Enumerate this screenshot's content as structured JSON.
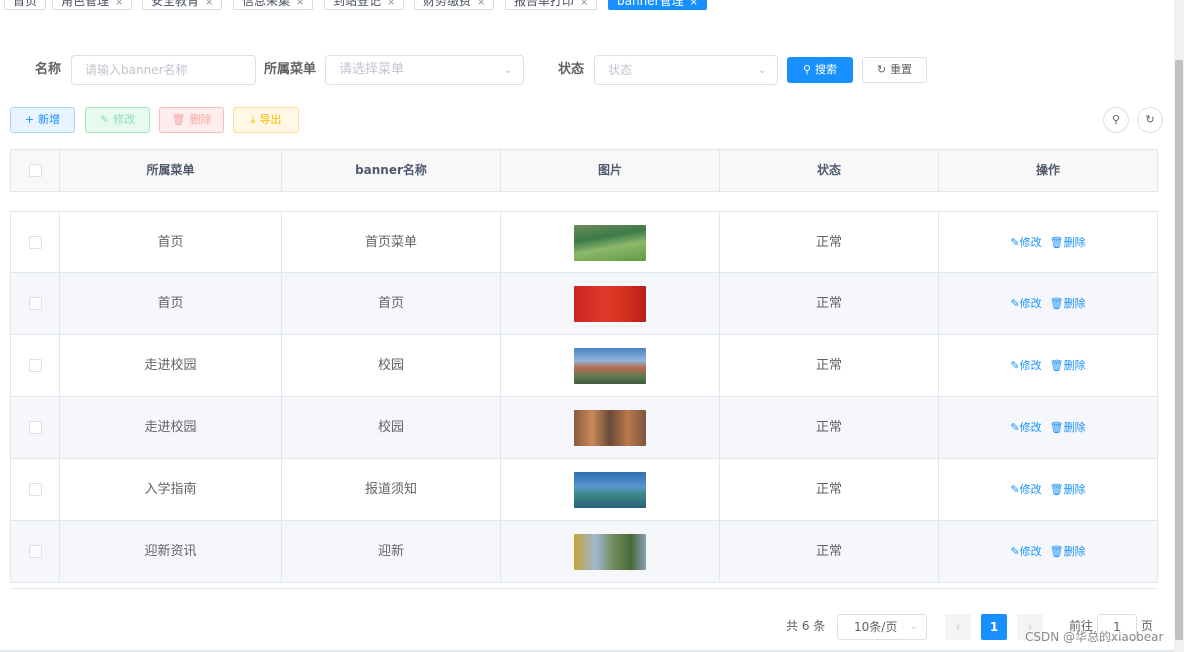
{
  "tags": [
    {
      "label": "首页",
      "closable": false
    },
    {
      "label": "角色管理",
      "closable": true
    },
    {
      "label": "安全教育",
      "closable": true
    },
    {
      "label": "信息采集",
      "closable": true
    },
    {
      "label": "到站登记",
      "closable": true
    },
    {
      "label": "财务缴费",
      "closable": true
    },
    {
      "label": "报告单打印",
      "closable": true
    },
    {
      "label": "banner管理",
      "closable": true,
      "active": true
    }
  ],
  "tag_close": "×",
  "search": {
    "name_label": "名称",
    "name_placeholder": "请输入banner名称",
    "menu_label": "所属菜单",
    "menu_placeholder": "请选择菜单",
    "status_label": "状态",
    "status_placeholder": "状态",
    "search_button": "搜索",
    "reset_button": "重置"
  },
  "toolbar": {
    "add": "新增",
    "edit": "修改",
    "delete": "删除",
    "export": "导出"
  },
  "table": {
    "columns": [
      "所属菜单",
      "banner名称",
      "图片",
      "状态",
      "操作"
    ],
    "rows": [
      {
        "menu": "首页",
        "name": "首页菜单",
        "image": "green-field-photo",
        "status": "正常"
      },
      {
        "menu": "首页",
        "name": "首页",
        "image": "red-festival-banner",
        "status": "正常"
      },
      {
        "menu": "走进校园",
        "name": "校园",
        "image": "campus-building-photo",
        "status": "正常"
      },
      {
        "menu": "走进校园",
        "name": "校园",
        "image": "autumn-campus-photo",
        "status": "正常"
      },
      {
        "menu": "入学指南",
        "name": "报道须知",
        "image": "campus-aerial-photo",
        "status": "正常"
      },
      {
        "menu": "迎新资讯",
        "name": "迎新",
        "image": "trees-building-photo",
        "status": "正常"
      }
    ],
    "op_edit": "修改",
    "op_delete": "删除"
  },
  "pagination": {
    "total": "共 6 条",
    "page_size": "10条/页",
    "current_page": "1",
    "goto_label": "前往",
    "goto_value": "1",
    "page_suffix": "页"
  },
  "watermark": "CSDN @华总的xiaobear",
  "colors": {
    "primary": "#1890ff",
    "header_bg": "#f8f8f9",
    "stripe_bg": "#f5f7fa"
  }
}
